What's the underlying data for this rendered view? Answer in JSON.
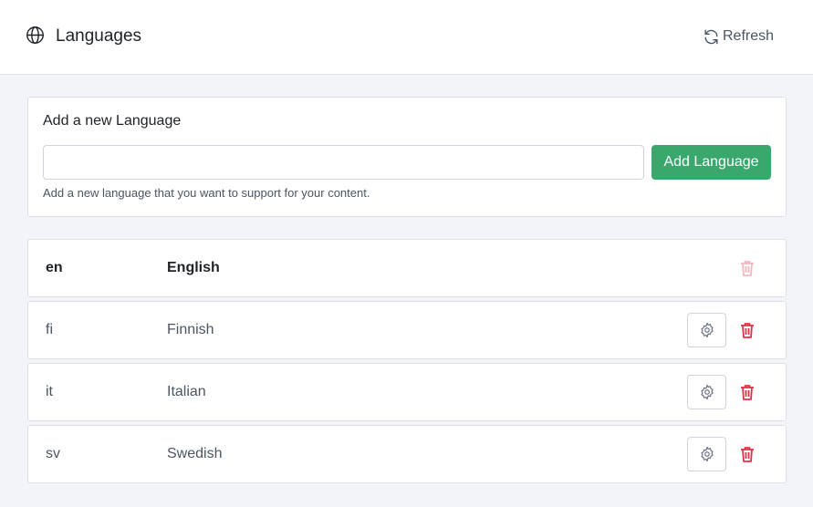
{
  "header": {
    "title": "Languages",
    "refresh_label": "Refresh"
  },
  "add_form": {
    "title": "Add a new Language",
    "input_value": "",
    "button_label": "Add Language",
    "help_text": "Add a new language that you want to support for your content."
  },
  "languages": [
    {
      "code": "en",
      "name": "English",
      "is_master": true
    },
    {
      "code": "fi",
      "name": "Finnish",
      "is_master": false
    },
    {
      "code": "it",
      "name": "Italian",
      "is_master": false
    },
    {
      "code": "sv",
      "name": "Swedish",
      "is_master": false
    }
  ],
  "colors": {
    "accent": "#3aa76d",
    "danger": "#e03347"
  },
  "icons": {
    "title": "globe-icon",
    "refresh": "refresh-icon",
    "settings": "gear-icon",
    "delete": "trash-icon"
  }
}
